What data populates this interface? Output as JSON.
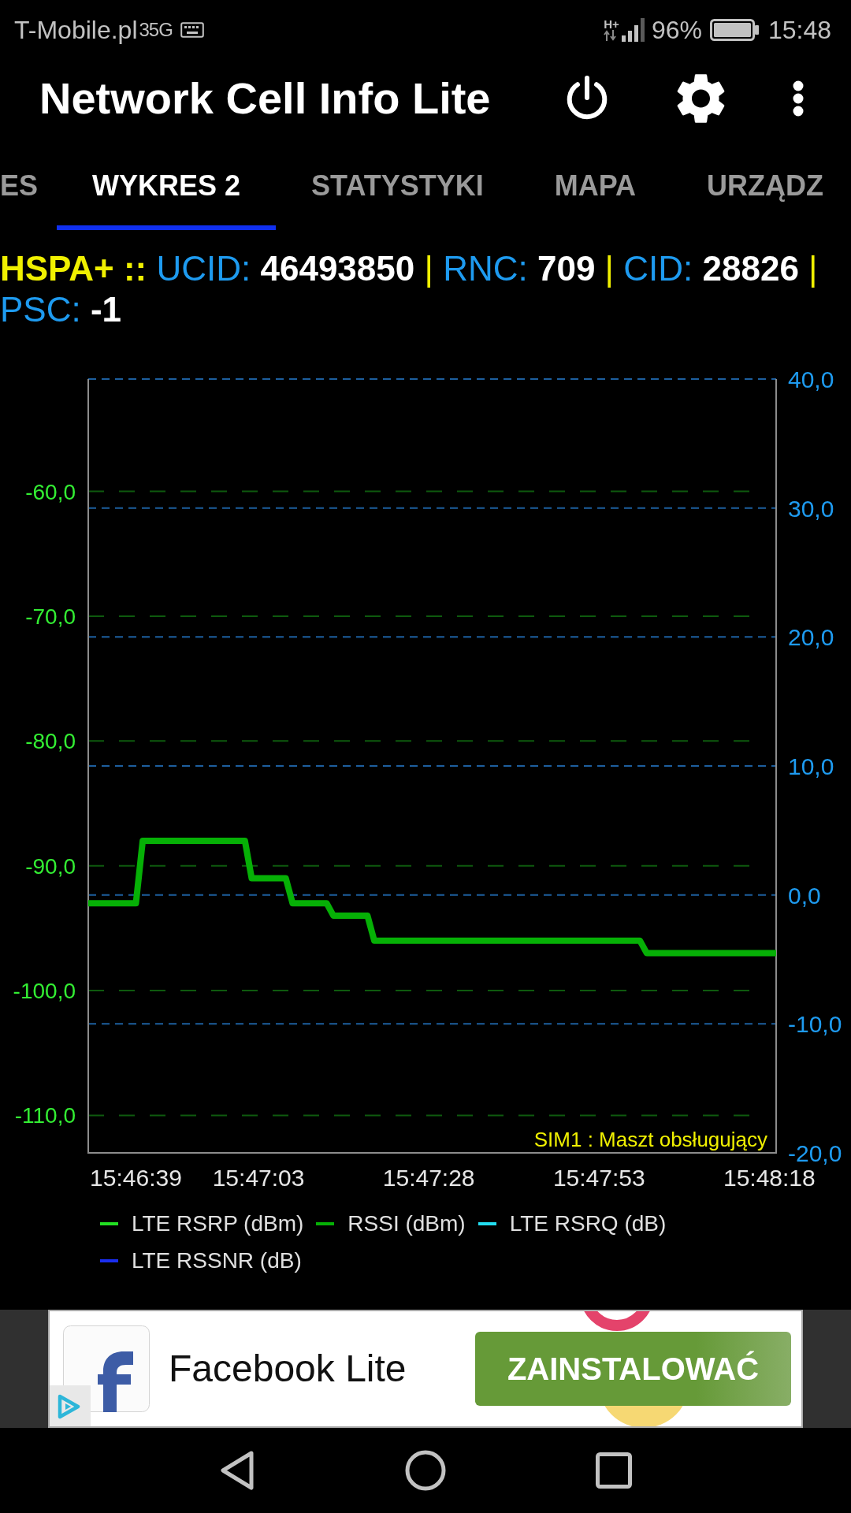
{
  "status_bar": {
    "carrier": "T-Mobile.pl",
    "notification_text": "35G",
    "network_type": "H+",
    "battery_percent": "96%",
    "time": "15:48"
  },
  "app_bar": {
    "title": "Network Cell Info Lite"
  },
  "tabs": [
    {
      "label": "ES",
      "selected": false
    },
    {
      "label": "WYKRES 2",
      "selected": true
    },
    {
      "label": "STATYSTYKI",
      "selected": false
    },
    {
      "label": "MAPA",
      "selected": false
    },
    {
      "label": "URZĄDZ",
      "selected": false
    }
  ],
  "cell_info": {
    "technology": "HSPA+",
    "marker": "::",
    "fields": [
      {
        "label": "UCID:",
        "value": "46493850",
        "separator": "|"
      },
      {
        "label": "RNC:",
        "value": "709",
        "separator": "|"
      },
      {
        "label": "CID:",
        "value": "28826",
        "separator": "|"
      },
      {
        "label": "PSC:",
        "value": "-1"
      }
    ]
  },
  "chart": {
    "chart_data": {
      "type": "line",
      "grid": true,
      "categories": [
        null,
        null,
        null,
        null,
        null,
        null,
        null,
        "15:46:39",
        null,
        null,
        null,
        null,
        null,
        null,
        null,
        null,
        null,
        null,
        null,
        null,
        null,
        null,
        null,
        null,
        null,
        "15:47:03",
        null,
        null,
        null,
        null,
        null,
        null,
        null,
        null,
        null,
        null,
        null,
        null,
        null,
        null,
        null,
        null,
        null,
        null,
        null,
        null,
        null,
        null,
        null,
        null,
        "15:47:28",
        null,
        null,
        null,
        null,
        null,
        null,
        null,
        null,
        null,
        null,
        null,
        null,
        null,
        null,
        null,
        null,
        null,
        null,
        null,
        null,
        null,
        null,
        null,
        null,
        "15:47:53",
        null,
        null,
        null,
        null,
        null,
        null,
        null,
        null,
        null,
        null,
        null,
        null,
        null,
        null,
        null,
        null,
        null,
        null,
        null,
        null,
        null,
        null,
        null,
        null,
        "15:48:18",
        null
      ],
      "series": [
        {
          "name": "LTE RSRP (dBm)",
          "color": "#22e022",
          "values": [
            null,
            null,
            null,
            null,
            null,
            null,
            null,
            null,
            null,
            null,
            null,
            null,
            null,
            null,
            null,
            null,
            null,
            null,
            null,
            null,
            null,
            null,
            null,
            null,
            null,
            null,
            null,
            null,
            null,
            null,
            null,
            null,
            null,
            null,
            null,
            null,
            null,
            null,
            null,
            null,
            null,
            null,
            null,
            null,
            null,
            null,
            null,
            null,
            null,
            null,
            null,
            null,
            null,
            null,
            null,
            null,
            null,
            null,
            null,
            null,
            null,
            null,
            null,
            null,
            null,
            null,
            null,
            null,
            null,
            null,
            null,
            null,
            null,
            null,
            null,
            null,
            null,
            null,
            null,
            null,
            null,
            null,
            null,
            null,
            null,
            null,
            null,
            null,
            null,
            null,
            null,
            null,
            null,
            null,
            null,
            null,
            null,
            null,
            null,
            null,
            null,
            null
          ]
        },
        {
          "name": "RSSI (dBm)",
          "color": "#06b006",
          "values": [
            -93,
            -93,
            -93,
            -93,
            -93,
            -93,
            -93,
            -93,
            -88,
            -88,
            -88,
            -88,
            -88,
            -88,
            -88,
            -88,
            -88,
            -88,
            -88,
            -88,
            -88,
            -88,
            -88,
            -88,
            -91,
            -91,
            -91,
            -91,
            -91,
            -91,
            -93,
            -93,
            -93,
            -93,
            -93,
            -93,
            -94,
            -94,
            -94,
            -94,
            -94,
            -94,
            -96,
            -96,
            -96,
            -96,
            -96,
            -96,
            -96,
            -96,
            -96,
            -96,
            -96,
            -96,
            -96,
            -96,
            -96,
            -96,
            -96,
            -96,
            -96,
            -96,
            -96,
            -96,
            -96,
            -96,
            -96,
            -96,
            -96,
            -96,
            -96,
            -96,
            -96,
            -96,
            -96,
            -96,
            -96,
            -96,
            -96,
            -96,
            -96,
            -96,
            -97,
            -97,
            -97,
            -97,
            -97,
            -97,
            -97,
            -97,
            -97,
            -97,
            -97,
            -97,
            -97,
            -97,
            -97,
            -97,
            -97,
            -97,
            -97,
            -97
          ]
        },
        {
          "name": "LTE RSRQ (dB)",
          "color": "#22ddf0",
          "values": [
            null,
            null,
            null,
            null,
            null,
            null,
            null,
            null,
            null,
            null,
            null,
            null,
            null,
            null,
            null,
            null,
            null,
            null,
            null,
            null,
            null,
            null,
            null,
            null,
            null,
            null,
            null,
            null,
            null,
            null,
            null,
            null,
            null,
            null,
            null,
            null,
            null,
            null,
            null,
            null,
            null,
            null,
            null,
            null,
            null,
            null,
            null,
            null,
            null,
            null,
            null,
            null,
            null,
            null,
            null,
            null,
            null,
            null,
            null,
            null,
            null,
            null,
            null,
            null,
            null,
            null,
            null,
            null,
            null,
            null,
            null,
            null,
            null,
            null,
            null,
            null,
            null,
            null,
            null,
            null,
            null,
            null,
            null,
            null,
            null,
            null,
            null,
            null,
            null,
            null,
            null,
            null,
            null,
            null,
            null,
            null,
            null,
            null,
            null,
            null,
            null,
            null
          ]
        },
        {
          "name": "LTE RSSNR (dB)",
          "color": "#1a2ef0",
          "values": [
            null,
            null,
            null,
            null,
            null,
            null,
            null,
            null,
            null,
            null,
            null,
            null,
            null,
            null,
            null,
            null,
            null,
            null,
            null,
            null,
            null,
            null,
            null,
            null,
            null,
            null,
            null,
            null,
            null,
            null,
            null,
            null,
            null,
            null,
            null,
            null,
            null,
            null,
            null,
            null,
            null,
            null,
            null,
            null,
            null,
            null,
            null,
            null,
            null,
            null,
            null,
            null,
            null,
            null,
            null,
            null,
            null,
            null,
            null,
            null,
            null,
            null,
            null,
            null,
            null,
            null,
            null,
            null,
            null,
            null,
            null,
            null,
            null,
            null,
            null,
            null,
            null,
            null,
            null,
            null,
            null,
            null,
            null,
            null,
            null,
            null,
            null,
            null,
            null,
            null,
            null,
            null,
            null,
            null,
            null,
            null,
            null,
            null,
            null,
            null,
            null,
            null
          ]
        }
      ],
      "ylim": [
        -113,
        -51
      ],
      "yticks": [
        {
          "value": -60,
          "label": "-60,0"
        },
        {
          "value": -70,
          "label": "-70,0"
        },
        {
          "value": -80,
          "label": "-80,0"
        },
        {
          "value": -90,
          "label": "-90,0"
        },
        {
          "value": -100,
          "label": "-100,0"
        },
        {
          "value": -110,
          "label": "-110,0"
        }
      ],
      "y2lim": [
        -20,
        40
      ],
      "y2ticks": [
        {
          "value": 40,
          "label": "40,0"
        },
        {
          "value": 30,
          "label": "30,0"
        },
        {
          "value": 20,
          "label": "20,0"
        },
        {
          "value": 10,
          "label": "10,0"
        },
        {
          "value": 0,
          "label": "0,0"
        },
        {
          "value": -10,
          "label": "-10,0"
        },
        {
          "value": -20,
          "label": "-20,0"
        }
      ],
      "annotations": [
        {
          "text": "SIM1 : Maszt obsługujący"
        }
      ]
    }
  },
  "ad": {
    "title": "Facebook Lite",
    "button": "ZAINSTALOWAĆ"
  }
}
